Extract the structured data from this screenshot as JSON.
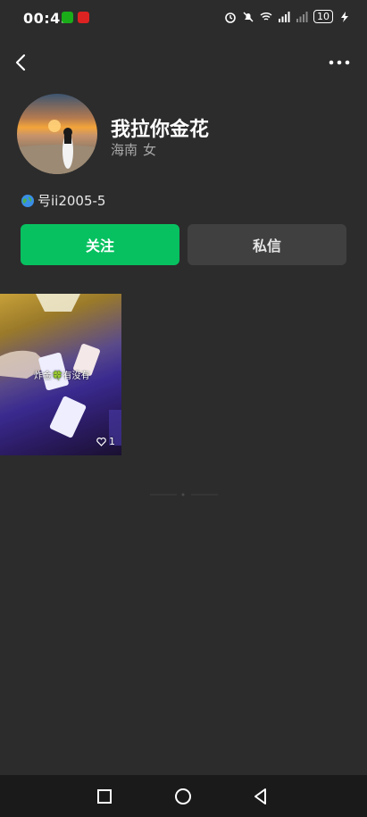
{
  "status_bar": {
    "time": "00:45",
    "battery": "10"
  },
  "profile": {
    "name": "我拉你金花",
    "region": "海南",
    "gender": "女",
    "id_text": "号ii2005-5"
  },
  "actions": {
    "follow": "关注",
    "message": "私信"
  },
  "videos": [
    {
      "caption": "炸金🍀有没有",
      "likes": "1"
    }
  ],
  "colors": {
    "background": "#2c2c2c",
    "accent": "#07c160",
    "secondary_button": "#404040"
  }
}
